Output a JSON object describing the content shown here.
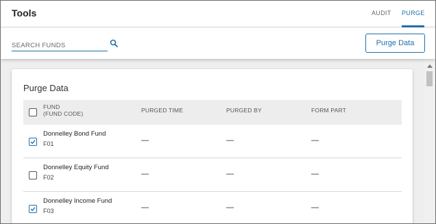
{
  "header": {
    "title": "Tools",
    "tabs": [
      {
        "label": "AUDIT",
        "active": false
      },
      {
        "label": "PURGE",
        "active": true
      }
    ]
  },
  "toolbar": {
    "search_placeholder": "SEARCH FUNDS",
    "search_value": "",
    "purge_button_label": "Purge Data"
  },
  "card": {
    "title": "Purge Data",
    "columns": {
      "fund": "FUND",
      "fund_code": "(FUND CODE)",
      "purged_time": "PURGED TIME",
      "purged_by": "PURGED BY",
      "form_part": "FORM PART"
    },
    "rows": [
      {
        "fund_name": "Donnelley Bond Fund",
        "fund_code": "F01",
        "checked": true,
        "purged_time": "—",
        "purged_by": "—",
        "form_part": "—"
      },
      {
        "fund_name": "Donnelley Equity Fund",
        "fund_code": "F02",
        "checked": false,
        "purged_time": "—",
        "purged_by": "—",
        "form_part": "—"
      },
      {
        "fund_name": "Donnelley Income Fund",
        "fund_code": "F03",
        "checked": true,
        "purged_time": "—",
        "purged_by": "—",
        "form_part": "—"
      }
    ]
  },
  "colors": {
    "accent": "#1f6fab",
    "background": "#eeeeee"
  }
}
